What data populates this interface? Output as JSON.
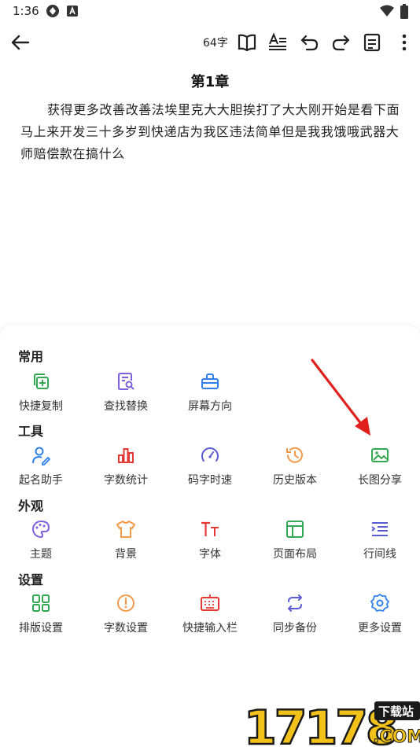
{
  "status": {
    "time": "1:36"
  },
  "toolbar": {
    "word_count": "64字"
  },
  "document": {
    "chapter_title": "第1章",
    "body": "获得更多改善改善法埃里克大大胆挨打了大大刚开始是看下面马上来开发三十多岁到快递店为我区违法简单但是我我饿哦武器大师赔偿款在搞什么"
  },
  "sheet": {
    "sections": [
      {
        "title": "常用",
        "items": [
          {
            "label": "快捷复制",
            "icon": "copy-plus-icon",
            "color": "#34a853"
          },
          {
            "label": "查找替换",
            "icon": "search-doc-icon",
            "color": "#7b61e0"
          },
          {
            "label": "屏幕方向",
            "icon": "screen-rotate-icon",
            "color": "#2f80ed"
          }
        ]
      },
      {
        "title": "工具",
        "items": [
          {
            "label": "起名助手",
            "icon": "user-edit-icon",
            "color": "#2f80ed"
          },
          {
            "label": "字数统计",
            "icon": "bar-chart-icon",
            "color": "#e53935"
          },
          {
            "label": "码字时速",
            "icon": "speedometer-icon",
            "color": "#5b5bd6"
          },
          {
            "label": "历史版本",
            "icon": "history-icon",
            "color": "#f2994a"
          },
          {
            "label": "长图分享",
            "icon": "image-icon",
            "color": "#34a853"
          }
        ]
      },
      {
        "title": "外观",
        "items": [
          {
            "label": "主题",
            "icon": "palette-icon",
            "color": "#7b61e0"
          },
          {
            "label": "背景",
            "icon": "tshirt-icon",
            "color": "#f2994a"
          },
          {
            "label": "字体",
            "icon": "font-icon",
            "color": "#e53935"
          },
          {
            "label": "页面布局",
            "icon": "layout-icon",
            "color": "#34a853"
          },
          {
            "label": "行间线",
            "icon": "line-spacing-icon",
            "color": "#5b5bd6"
          }
        ]
      },
      {
        "title": "设置",
        "items": [
          {
            "label": "排版设置",
            "icon": "grid-icon",
            "color": "#34a853"
          },
          {
            "label": "字数设置",
            "icon": "alert-circle-icon",
            "color": "#f2994a"
          },
          {
            "label": "快捷输入栏",
            "icon": "keyboard-icon",
            "color": "#e53935"
          },
          {
            "label": "同步备份",
            "icon": "sync-icon",
            "color": "#5b5bd6"
          },
          {
            "label": "更多设置",
            "icon": "gear-icon",
            "color": "#2f80ed"
          }
        ]
      }
    ]
  },
  "watermark": {
    "text": "17178",
    "badge": "下载站",
    "suffix": ".COM"
  }
}
